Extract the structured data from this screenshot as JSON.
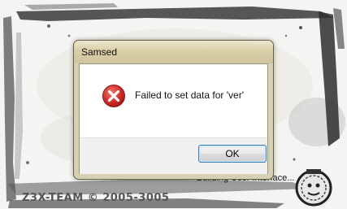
{
  "splash": {
    "status_text": "Building User Interface...",
    "copyright": "Z3X-TEAM © 2005-3005"
  },
  "dialog": {
    "title": "Samsed",
    "icon": "error-icon",
    "message": "Failed to set data for 'ver'",
    "ok_label": "OK"
  },
  "colors": {
    "error_red": "#d9312e",
    "dialog_frame": "#d6d0b4",
    "button_border": "#3c7fb1"
  }
}
